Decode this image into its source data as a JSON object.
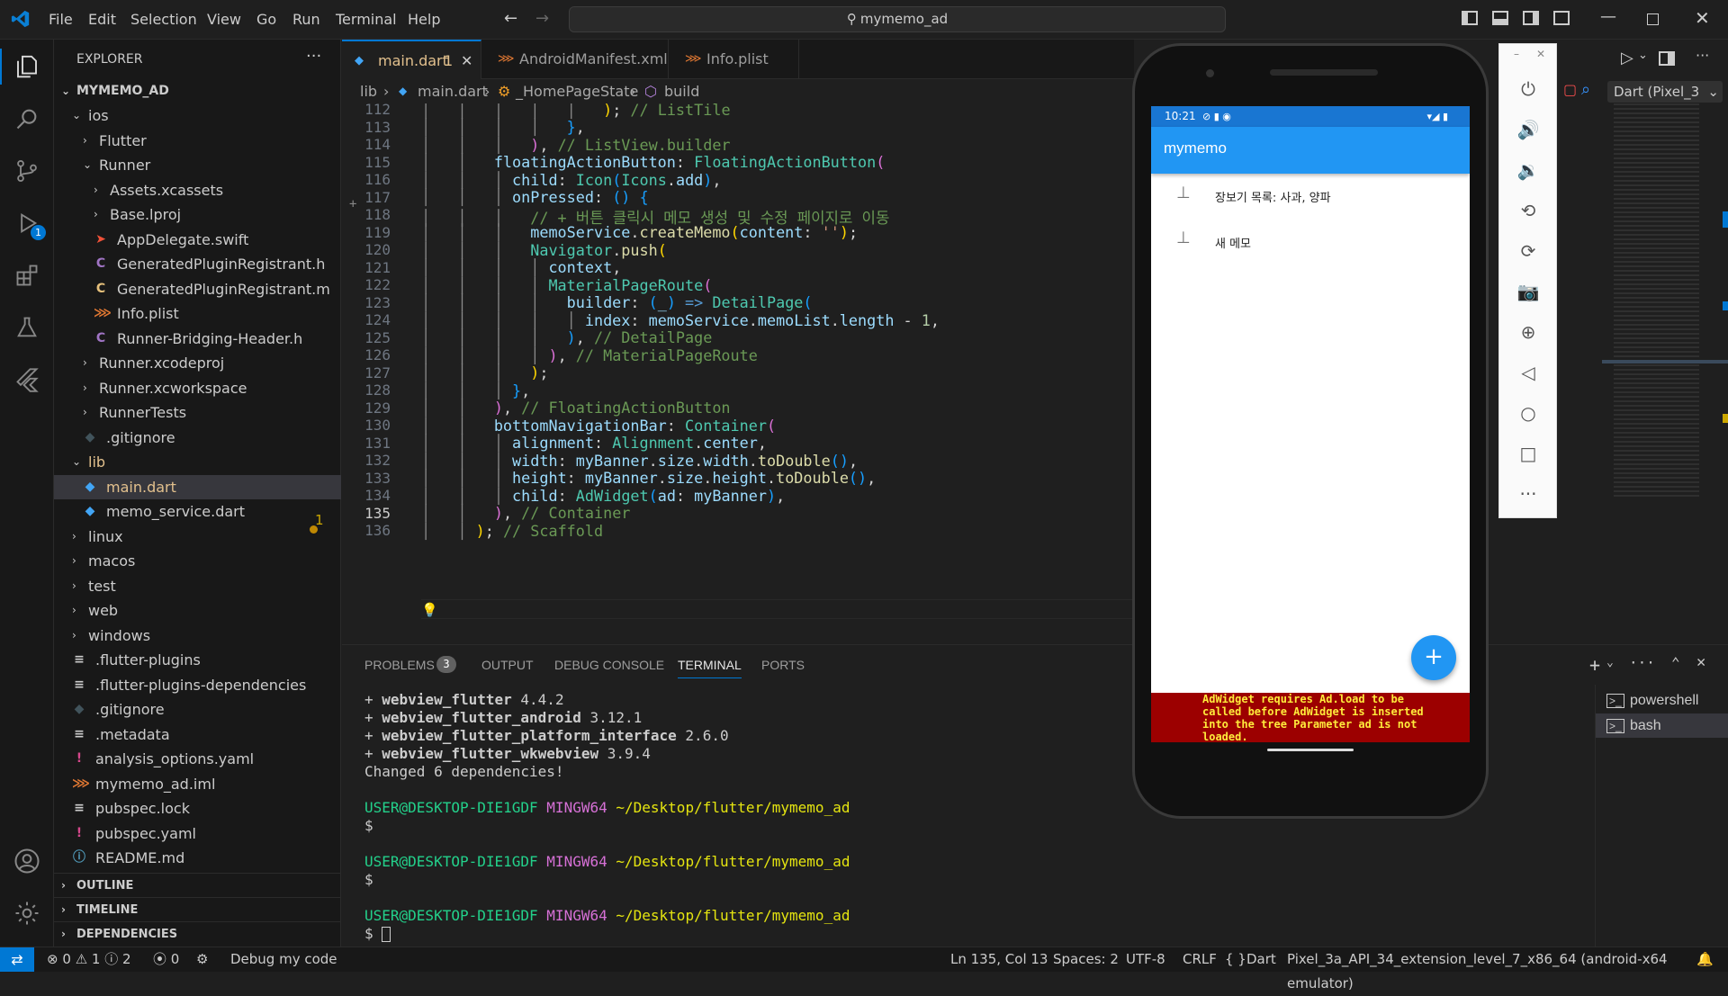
{
  "titlebar": {
    "menus": [
      "File",
      "Edit",
      "Selection",
      "View",
      "Go",
      "Run",
      "Terminal",
      "Help"
    ],
    "search": "mymemo_ad"
  },
  "activity": {
    "debug_badge": "1"
  },
  "explorer": {
    "header": "EXPLORER",
    "root": "MYMEMO_AD",
    "rows": [
      {
        "label": "ios",
        "kind": "folder-open",
        "depth": 1
      },
      {
        "label": "Flutter",
        "kind": "folder",
        "depth": 2
      },
      {
        "label": "Runner",
        "kind": "folder-open",
        "depth": 2
      },
      {
        "label": "Assets.xcassets",
        "kind": "folder",
        "depth": 3
      },
      {
        "label": "Base.lproj",
        "kind": "folder",
        "depth": 3
      },
      {
        "label": "AppDelegate.swift",
        "kind": "swift",
        "depth": 3
      },
      {
        "label": "GeneratedPluginRegistrant.h",
        "kind": "c",
        "depth": 3
      },
      {
        "label": "GeneratedPluginRegistrant.m",
        "kind": "m",
        "depth": 3
      },
      {
        "label": "Info.plist",
        "kind": "rss",
        "depth": 3
      },
      {
        "label": "Runner-Bridging-Header.h",
        "kind": "c",
        "depth": 3
      },
      {
        "label": "Runner.xcodeproj",
        "kind": "folder",
        "depth": 2
      },
      {
        "label": "Runner.xcworkspace",
        "kind": "folder",
        "depth": 2
      },
      {
        "label": "RunnerTests",
        "kind": "folder",
        "depth": 2
      },
      {
        "label": ".gitignore",
        "kind": "git",
        "depth": 2
      },
      {
        "label": "lib",
        "kind": "folder-open",
        "depth": 1
      },
      {
        "label": "main.dart",
        "kind": "dart",
        "depth": 2
      },
      {
        "label": "memo_service.dart",
        "kind": "dart",
        "depth": 2
      },
      {
        "label": "linux",
        "kind": "folder",
        "depth": 1
      },
      {
        "label": "macos",
        "kind": "folder",
        "depth": 1
      },
      {
        "label": "test",
        "kind": "folder",
        "depth": 1
      },
      {
        "label": "web",
        "kind": "folder",
        "depth": 1
      },
      {
        "label": "windows",
        "kind": "folder",
        "depth": 1
      },
      {
        "label": ".flutter-plugins",
        "kind": "lines",
        "depth": 1
      },
      {
        "label": ".flutter-plugins-dependencies",
        "kind": "lines",
        "depth": 1
      },
      {
        "label": ".gitignore",
        "kind": "git",
        "depth": 1
      },
      {
        "label": ".metadata",
        "kind": "lines",
        "depth": 1
      },
      {
        "label": "analysis_options.yaml",
        "kind": "yaml",
        "depth": 1
      },
      {
        "label": "mymemo_ad.iml",
        "kind": "rss",
        "depth": 1
      },
      {
        "label": "pubspec.lock",
        "kind": "lines",
        "depth": 1
      },
      {
        "label": "pubspec.yaml",
        "kind": "yaml",
        "depth": 1
      },
      {
        "label": "README.md",
        "kind": "info",
        "depth": 1
      }
    ],
    "main_dart_badge": "1",
    "sections": [
      "OUTLINE",
      "TIMELINE",
      "DEPENDENCIES"
    ]
  },
  "tabs": [
    {
      "label": "main.dart",
      "badge": "1",
      "active": true
    },
    {
      "label": "AndroidManifest.xml",
      "active": false
    },
    {
      "label": "Info.plist",
      "active": false
    }
  ],
  "breadcrumb": [
    "lib",
    "main.dart",
    "_HomePageState",
    "build"
  ],
  "code": {
    "line_numbers": [
      "112",
      "113",
      "114",
      "115",
      "116",
      "117",
      "118",
      "119",
      "120",
      "121",
      "122",
      "123",
      "124",
      "125",
      "126",
      "127",
      "128",
      "129",
      "130",
      "131",
      "132",
      "133",
      "134",
      "135",
      "136"
    ],
    "current_line": "135"
  },
  "panel": {
    "tabs": [
      "PROBLEMS",
      "OUTPUT",
      "DEBUG CONSOLE",
      "TERMINAL",
      "PORTS"
    ],
    "problems_count": "3",
    "terminal": {
      "deps": [
        {
          "name": "webview_flutter",
          "ver": "4.4.2"
        },
        {
          "name": "webview_flutter_android",
          "ver": "3.12.1"
        },
        {
          "name": "webview_flutter_platform_interface",
          "ver": "2.6.0"
        },
        {
          "name": "webview_flutter_wkwebview",
          "ver": "3.9.4"
        }
      ],
      "changed": "Changed 6 dependencies!",
      "user": "USER@DESKTOP-DIE1GDF",
      "host": "MINGW64",
      "path": "~/Desktop/flutter/mymemo_ad",
      "prompt": "$"
    },
    "shells": [
      "powershell",
      "bash"
    ]
  },
  "right_header": {
    "device_select": "Dart (Pixel_3"
  },
  "phone": {
    "time": "10:21",
    "app_title": "mymemo",
    "memos": [
      "장보기 목록: 사과, 양파",
      "새 메모"
    ],
    "fab": "+",
    "ad_error": "AdWidget requires Ad.load to be called before AdWidget is inserted into the tree Parameter ad is not loaded."
  },
  "status": {
    "errors": "0",
    "warnings": "1",
    "infos": "2",
    "ports": "0",
    "debug": "Debug my code",
    "position": "Ln 135, Col 13",
    "spaces": "Spaces: 2",
    "encoding": "UTF-8",
    "eol": "CRLF",
    "language": "Dart",
    "device": "Pixel_3a_API_34_extension_level_7_x86_64 (android-x64 emulator)"
  },
  "colors": {
    "accent": "#0078d4",
    "appbar": "#2196f3",
    "fab": "#2196f3",
    "ad_error_bg": "#9c0000",
    "ad_error_text": "#ffeb3b"
  }
}
